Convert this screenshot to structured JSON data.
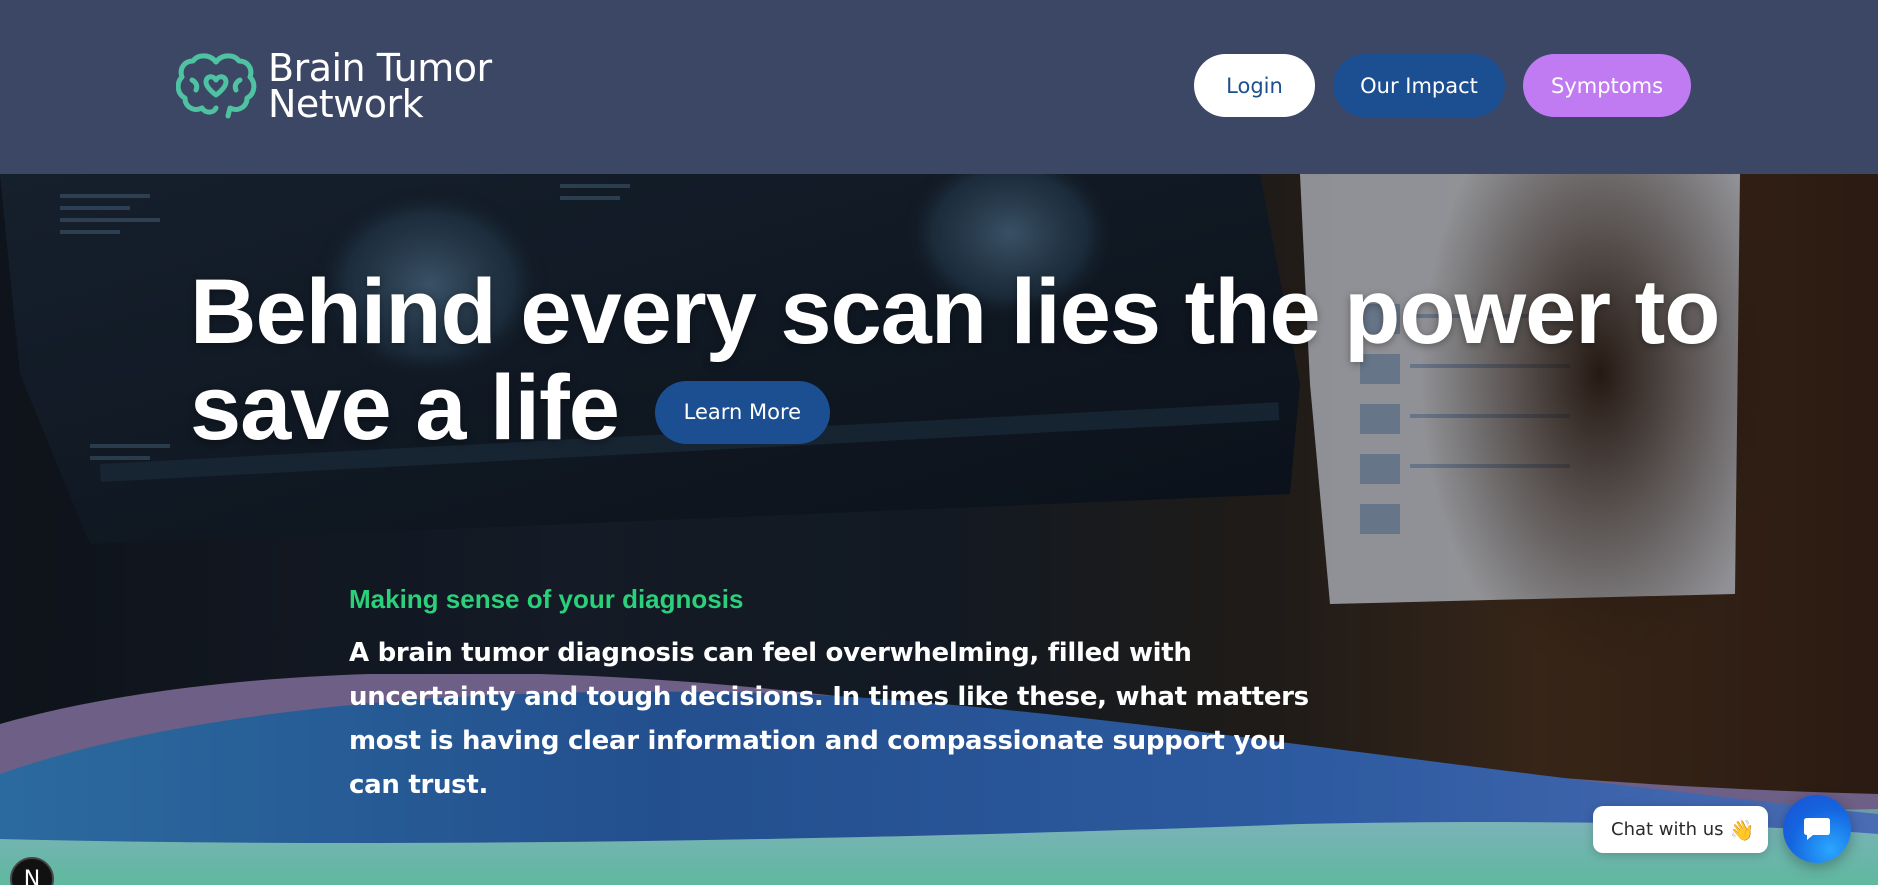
{
  "header": {
    "logo": {
      "line1": "Brain Tumor",
      "line2": "Network",
      "icon": "brain-heart-icon"
    },
    "nav": {
      "login": "Login",
      "impact": "Our Impact",
      "symptoms": "Symptoms"
    }
  },
  "hero": {
    "title_line1": "Behind every scan lies the power to",
    "title_line2": "save a life",
    "cta": "Learn More"
  },
  "info": {
    "kicker": "Making sense of your diagnosis",
    "body": "A brain tumor diagnosis can feel overwhelming, filled with uncertainty and tough decisions. In times like these, what matters most is having clear information and compassionate support you can trust."
  },
  "chat": {
    "label": "Chat with us",
    "emoji": "👋",
    "icon": "chat-bubble-icon"
  },
  "dev_badge": {
    "letter": "N"
  },
  "colors": {
    "header_bg": "#3c4665",
    "brand_teal": "#4fc3a1",
    "brand_blue": "#1b4f92",
    "brand_purple": "#c17bf2",
    "kicker_green": "#2bd07a"
  }
}
